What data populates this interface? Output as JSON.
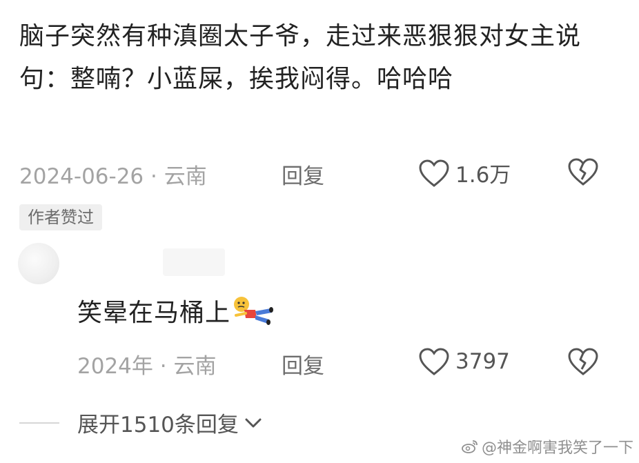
{
  "comment": {
    "text": "脑子突然有种滇圈太子爷，走过来恶狠狠对女主说句：整喃？小蓝屎，挨我闷得。哈哈哈",
    "date_location": "2024-06-26 · 云南",
    "reply_label": "回复",
    "like_count": "1.6万",
    "badge": "作者赞过",
    "icons": {
      "like": "heart-outline-icon",
      "dislike": "broken-heart-icon"
    }
  },
  "reply": {
    "text": "笑晕在马桶上",
    "emoji": "lying-figure-emoji",
    "date_location": "2024年 · 云南",
    "reply_label": "回复",
    "like_count": "3797"
  },
  "expand": {
    "label": "展开1510条回复"
  },
  "watermark": {
    "text": "@神金啊害我笑了一下",
    "icon": "weibo-icon"
  },
  "colors": {
    "text": "#222222",
    "meta": "#a3a3a3",
    "badge_bg": "#efefef",
    "icon": "#555555"
  }
}
